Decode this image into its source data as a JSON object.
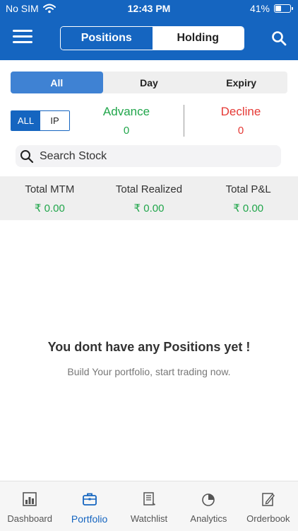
{
  "status": {
    "carrier": "No SIM",
    "time": "12:43 PM",
    "battery": "41%",
    "battery_level": 0.41
  },
  "header": {
    "tabs": [
      "Positions",
      "Holding"
    ],
    "active_tab": "Positions",
    "menu_icon": "hamburger-menu-icon",
    "search_icon": "search-icon"
  },
  "filter": {
    "items": [
      "All",
      "Day",
      "Expiry"
    ],
    "active": "All"
  },
  "mini_toggle": {
    "items": [
      "ALL",
      "IP"
    ],
    "active": "ALL"
  },
  "advance": {
    "label": "Advance",
    "value": "0"
  },
  "decline": {
    "label": "Decline",
    "value": "0"
  },
  "search": {
    "placeholder": "Search Stock"
  },
  "totals": [
    {
      "label": "Total MTM",
      "value": "₹ 0.00"
    },
    {
      "label": "Total Realized",
      "value": "₹ 0.00"
    },
    {
      "label": "Total P&L",
      "value": "₹ 0.00"
    }
  ],
  "empty_state": {
    "title": "You dont have any Positions yet !",
    "subtitle": "Build Your portfolio, start trading now."
  },
  "nav": [
    {
      "label": "Dashboard",
      "icon": "bar-chart-icon"
    },
    {
      "label": "Portfolio",
      "icon": "briefcase-icon"
    },
    {
      "label": "Watchlist",
      "icon": "list-icon"
    },
    {
      "label": "Analytics",
      "icon": "pie-chart-icon"
    },
    {
      "label": "Orderbook",
      "icon": "notebook-edit-icon"
    }
  ],
  "active_nav": "Portfolio",
  "colors": {
    "primary": "#1565c0",
    "positive": "#21a64b",
    "negative": "#e53935",
    "filter_active": "#3f82d3"
  }
}
